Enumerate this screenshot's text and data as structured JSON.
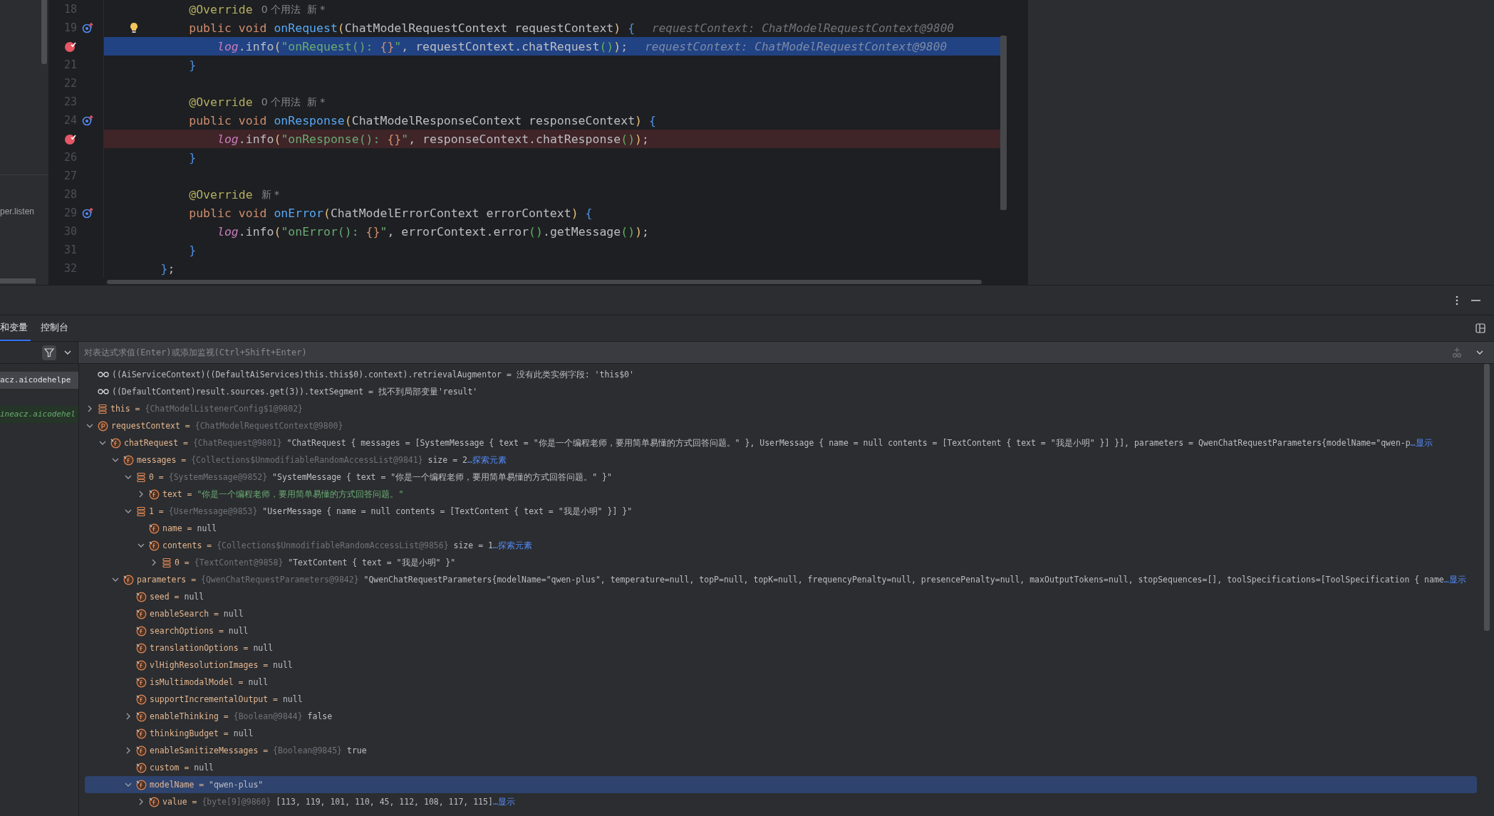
{
  "project_panel": {
    "item": "per.listen"
  },
  "editor": {
    "lines": [
      {
        "number": "18",
        "current": false,
        "tokens": [
          {
            "kind": "ann",
            "text": "            @Override"
          }
        ],
        "inlay": "0 个用法  新 *"
      },
      {
        "number": "19",
        "current": false,
        "override_marker": true,
        "bulb": true,
        "tokens": [
          {
            "kind": "kw",
            "text": "            public void "
          },
          {
            "kind": "fn",
            "text": "onRequest"
          },
          {
            "kind": "p1",
            "text": "("
          },
          {
            "kind": "txt",
            "text": "ChatModelRequestContext requestContext"
          },
          {
            "kind": "p1",
            "text": ") "
          },
          {
            "kind": "p3",
            "text": "{"
          }
        ],
        "hint": "requestContext: ChatModelRequestContext@9800"
      },
      {
        "breakpoint": true,
        "current": true,
        "tokens": [
          {
            "kind": "log",
            "text": "                log"
          },
          {
            "kind": "txt",
            "text": ".info"
          },
          {
            "kind": "p1",
            "text": "("
          },
          {
            "kind": "str",
            "text": "\"onRequest(): "
          },
          {
            "kind": "fmt",
            "text": "{}"
          },
          {
            "kind": "str",
            "text": "\""
          },
          {
            "kind": "txt",
            "text": ", requestContext.chatRequest"
          },
          {
            "kind": "p2",
            "text": "()"
          },
          {
            "kind": "p1",
            "text": ")"
          },
          {
            "kind": "txt",
            "text": ";"
          }
        ],
        "hint": "requestContext: ChatModelRequestContext@9800"
      },
      {
        "number": "21",
        "current": false,
        "tokens": [
          {
            "kind": "p3",
            "text": "            }"
          }
        ]
      },
      {
        "number": "22",
        "current": false
      },
      {
        "number": "23",
        "current": false,
        "tokens": [
          {
            "kind": "ann",
            "text": "            @Override"
          }
        ],
        "inlay": "0 个用法  新 *"
      },
      {
        "number": "24",
        "current": false,
        "override_marker": true,
        "tokens": [
          {
            "kind": "kw",
            "text": "            public void "
          },
          {
            "kind": "fn",
            "text": "onResponse"
          },
          {
            "kind": "p1",
            "text": "("
          },
          {
            "kind": "txt",
            "text": "ChatModelResponseContext responseContext"
          },
          {
            "kind": "p1",
            "text": ") "
          },
          {
            "kind": "p3",
            "text": "{"
          }
        ]
      },
      {
        "breakpoint": true,
        "current": false,
        "tokens": [
          {
            "kind": "log",
            "text": "                log"
          },
          {
            "kind": "txt",
            "text": ".info"
          },
          {
            "kind": "p1",
            "text": "("
          },
          {
            "kind": "str",
            "text": "\"onResponse(): "
          },
          {
            "kind": "fmt",
            "text": "{}"
          },
          {
            "kind": "str",
            "text": "\""
          },
          {
            "kind": "txt",
            "text": ", responseContext.chatResponse"
          },
          {
            "kind": "p2",
            "text": "()"
          },
          {
            "kind": "p1",
            "text": ")"
          },
          {
            "kind": "txt",
            "text": ";"
          }
        ]
      },
      {
        "number": "26",
        "current": false,
        "tokens": [
          {
            "kind": "p3",
            "text": "            }"
          }
        ]
      },
      {
        "number": "27",
        "current": false
      },
      {
        "number": "28",
        "current": false,
        "tokens": [
          {
            "kind": "ann",
            "text": "            @Override"
          }
        ],
        "inlay": "新 *"
      },
      {
        "number": "29",
        "current": false,
        "override_marker": true,
        "tokens": [
          {
            "kind": "kw",
            "text": "            public void "
          },
          {
            "kind": "fn",
            "text": "onError"
          },
          {
            "kind": "p1",
            "text": "("
          },
          {
            "kind": "txt",
            "text": "ChatModelErrorContext errorContext"
          },
          {
            "kind": "p1",
            "text": ") "
          },
          {
            "kind": "p3",
            "text": "{"
          }
        ]
      },
      {
        "number": "30",
        "current": false,
        "tokens": [
          {
            "kind": "log",
            "text": "                log"
          },
          {
            "kind": "txt",
            "text": ".info"
          },
          {
            "kind": "p1",
            "text": "("
          },
          {
            "kind": "str",
            "text": "\"onError(): "
          },
          {
            "kind": "fmt",
            "text": "{}"
          },
          {
            "kind": "str",
            "text": "\""
          },
          {
            "kind": "txt",
            "text": ", errorContext.error"
          },
          {
            "kind": "p2",
            "text": "()"
          },
          {
            "kind": "txt",
            "text": ".getMessage"
          },
          {
            "kind": "p2",
            "text": "()"
          },
          {
            "kind": "p1",
            "text": ")"
          },
          {
            "kind": "txt",
            "text": ";"
          }
        ]
      },
      {
        "number": "31",
        "current": false,
        "tokens": [
          {
            "kind": "p3",
            "text": "            }"
          }
        ]
      },
      {
        "number": "32",
        "current": false,
        "tokens": [
          {
            "kind": "p3",
            "text": "        }"
          },
          {
            "kind": "txt",
            "text": ";"
          }
        ]
      }
    ]
  },
  "debug": {
    "tabs": [
      {
        "label": "和变量",
        "selected": true
      },
      {
        "label": "控制台",
        "selected": false
      }
    ],
    "expression_field": {
      "placeholder": "对表达式求值(Enter)或添加监视(Ctrl+Shift+Enter)"
    },
    "frames": [
      {
        "label": "acz.aicodehelpe",
        "selected": true,
        "kind": "frame"
      },
      {
        "label": "ineacz.aicodehel",
        "selected": false,
        "kind": "library"
      }
    ],
    "variables": [
      {
        "kind": "watch",
        "name": "((AiServiceContext)((DefaultAiServices)this.this$0).context).retrievalAugmentor =",
        "value": "没有此类实例字段: 'this$0'",
        "selected": false
      },
      {
        "kind": "watch",
        "name": "((DefaultContent)result.sources.get(3)).textSegment =",
        "value": "找不到局部变量'result'",
        "selected": false
      },
      {
        "kind": "stack",
        "name": "this =",
        "type": "{ChatModelListenerConfig$1@9802}",
        "expanded": false,
        "selected": false
      },
      {
        "kind": "param",
        "name": "requestContext =",
        "type": "{ChatModelRequestContext@9800}",
        "expanded": true,
        "selected": false,
        "children": [
          {
            "kind": "field",
            "name": "chatRequest =",
            "type": "{ChatRequest@9801}",
            "value": "\"ChatRequest { messages = [SystemMessage { text = \"你是一个编程老师，要用简单易懂的方式回答问题。\" }, UserMessage { name = null contents = [TextContent { text = \"我是小明\" }] }], parameters = QwenChatRequestParameters{modelName=\"qwen-p",
            "link": "…显示",
            "expanded": true,
            "selected": false,
            "children": [
              {
                "kind": "field",
                "name": "messages =",
                "type": "{Collections$UnmodifiableRandomAccessList@9841}",
                "size": "size = 2",
                "link": "…探索元素",
                "expanded": true,
                "selected": false,
                "children": [
                  {
                    "kind": "stack",
                    "name": "0 =",
                    "type": "{SystemMessage@9852}",
                    "value": "\"SystemMessage { text = \"你是一个编程老师，要用简单易懂的方式回答问题。\" }\"",
                    "expanded": true,
                    "selected": false,
                    "children": [
                      {
                        "kind": "string",
                        "name": "text =",
                        "value": "\"你是一个编程老师，要用简单易懂的方式回答问题。\"",
                        "expanded": false,
                        "selected": false
                      }
                    ]
                  },
                  {
                    "kind": "stack",
                    "name": "1 =",
                    "type": "{UserMessage@9853}",
                    "value": "\"UserMessage { name = null contents = [TextContent { text = \"我是小明\" }] }\"",
                    "expanded": true,
                    "selected": false,
                    "children": [
                      {
                        "kind": "field",
                        "name": "name =",
                        "value": "null",
                        "selected": false
                      },
                      {
                        "kind": "field",
                        "name": "contents =",
                        "type": "{Collections$UnmodifiableRandomAccessList@9856}",
                        "size": "size = 1",
                        "link": "…探索元素",
                        "expanded": true,
                        "selected": false,
                        "children": [
                          {
                            "kind": "stack",
                            "name": "0 =",
                            "type": "{TextContent@9858}",
                            "value": "\"TextContent { text = \"我是小明\" }\"",
                            "expanded": false,
                            "selected": false
                          }
                        ]
                      }
                    ]
                  }
                ]
              },
              {
                "kind": "field",
                "name": "parameters =",
                "type": "{QwenChatRequestParameters@9842}",
                "value": "\"QwenChatRequestParameters{modelName=\"qwen-plus\", temperature=null, topP=null, topK=null, frequencyPenalty=null, presencePenalty=null, maxOutputTokens=null, stopSequences=[], toolSpecifications=[ToolSpecification { name",
                "link": "…显示",
                "expanded": true,
                "selected": false,
                "children": [
                  {
                    "kind": "field",
                    "name": "seed =",
                    "value": "null",
                    "selected": false
                  },
                  {
                    "kind": "field",
                    "name": "enableSearch =",
                    "value": "null",
                    "selected": false
                  },
                  {
                    "kind": "field",
                    "name": "searchOptions =",
                    "value": "null",
                    "selected": false
                  },
                  {
                    "kind": "field",
                    "name": "translationOptions =",
                    "value": "null",
                    "selected": false
                  },
                  {
                    "kind": "field",
                    "name": "vlHighResolutionImages =",
                    "value": "null",
                    "selected": false
                  },
                  {
                    "kind": "field",
                    "name": "isMultimodalModel =",
                    "value": "null",
                    "selected": false
                  },
                  {
                    "kind": "field",
                    "name": "supportIncrementalOutput =",
                    "value": "null",
                    "selected": false
                  },
                  {
                    "kind": "field",
                    "name": "enableThinking =",
                    "type": "{Boolean@9844}",
                    "value": "false",
                    "expanded": false,
                    "selected": false
                  },
                  {
                    "kind": "field",
                    "name": "thinkingBudget =",
                    "value": "null",
                    "selected": false
                  },
                  {
                    "kind": "field",
                    "name": "enableSanitizeMessages =",
                    "type": "{Boolean@9845}",
                    "value": "true",
                    "expanded": false,
                    "selected": false
                  },
                  {
                    "kind": "field",
                    "name": "custom =",
                    "value": "null",
                    "selected": false
                  },
                  {
                    "kind": "field",
                    "name": "modelName =",
                    "value": "\"qwen-plus\"",
                    "expanded": true,
                    "selected": true,
                    "children": [
                      {
                        "kind": "field",
                        "name": "value =",
                        "type": "{byte[9]@9860}",
                        "value": "[113, 119, 101, 110, 45, 112, 108, 117, 115]",
                        "link": "…显示",
                        "expanded": false,
                        "selected": false
                      }
                    ]
                  }
                ]
              }
            ]
          }
        ]
      }
    ]
  }
}
